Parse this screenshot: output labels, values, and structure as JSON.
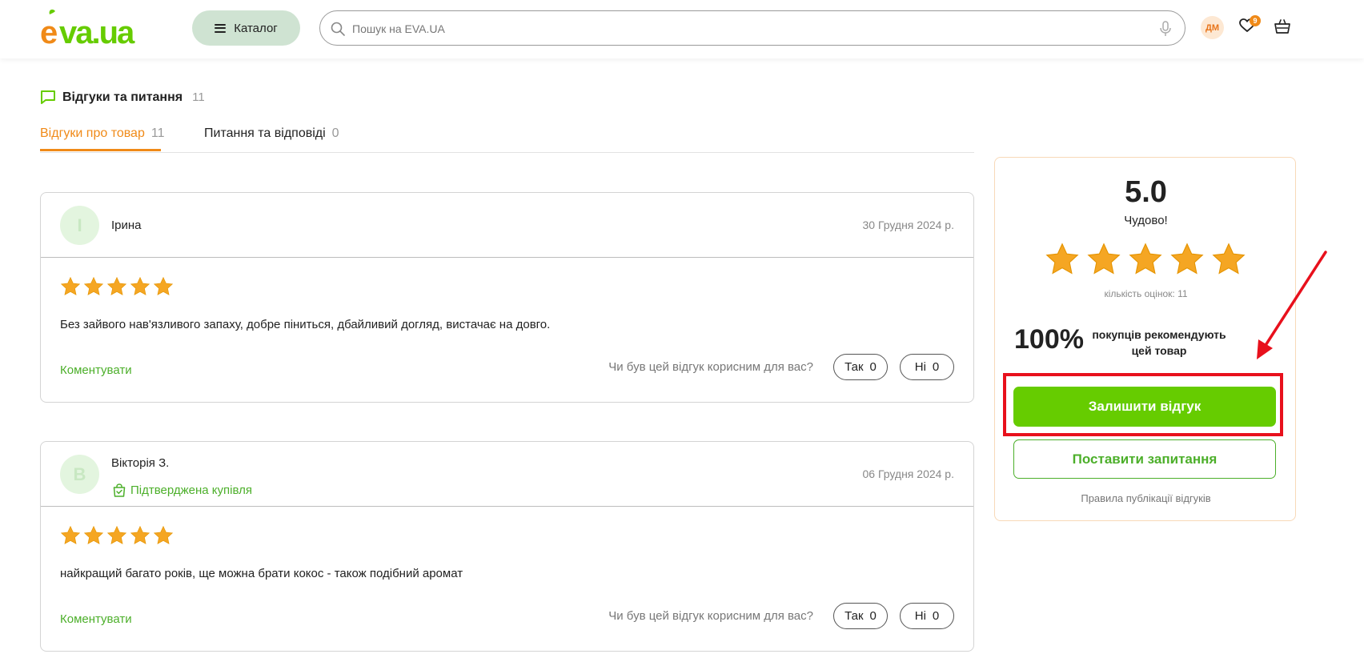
{
  "header": {
    "logo_text": "eva.ua",
    "catalog_label": "Каталог",
    "search_placeholder": "Пошук на EVA.UA",
    "avatar_initials": "ДМ",
    "wishlist_count": "9"
  },
  "section": {
    "title": "Відгуки та питання",
    "count": "11"
  },
  "tabs": [
    {
      "label": "Відгуки про товар",
      "count": "11"
    },
    {
      "label": "Питання та відповіді",
      "count": "0"
    }
  ],
  "reviews": [
    {
      "initial": "І",
      "name": "Ірина",
      "verified": "",
      "date": "30 Грудня 2024 р.",
      "rating": 5,
      "text": "Без зайвого нав'язливого запаху, добре піниться, дбайливий догляд, вистачає на довго.",
      "comment_label": "Коментувати",
      "helpful_question": "Чи був цей відгук корисним для вас?",
      "yes_label": "Так",
      "yes_count": "0",
      "no_label": "Ні",
      "no_count": "0"
    },
    {
      "initial": "В",
      "name": "Вікторія З.",
      "verified": "Підтверджена купівля",
      "date": "06 Грудня 2024 р.",
      "rating": 5,
      "text": "найкращий багато років, ще можна брати кокос - також подібний аромат",
      "comment_label": "Коментувати",
      "helpful_question": "Чи був цей відгук корисним для вас?",
      "yes_label": "Так",
      "yes_count": "0",
      "no_label": "Ні",
      "no_count": "0"
    }
  ],
  "summary": {
    "score": "5.0",
    "score_label": "Чудово!",
    "rating": 5,
    "rating_count": "кількість оцінок: 11",
    "percent": "100%",
    "percent_text": "покупців рекомендують цей товар",
    "leave_review_label": "Залишити відгук",
    "ask_question_label": "Поставити запитання",
    "rules_label": "Правила публікації відгуків"
  },
  "colors": {
    "brand_green": "#66cc00",
    "brand_orange": "#f08a18",
    "star": "#f5a623",
    "highlight": "#e8101c"
  }
}
